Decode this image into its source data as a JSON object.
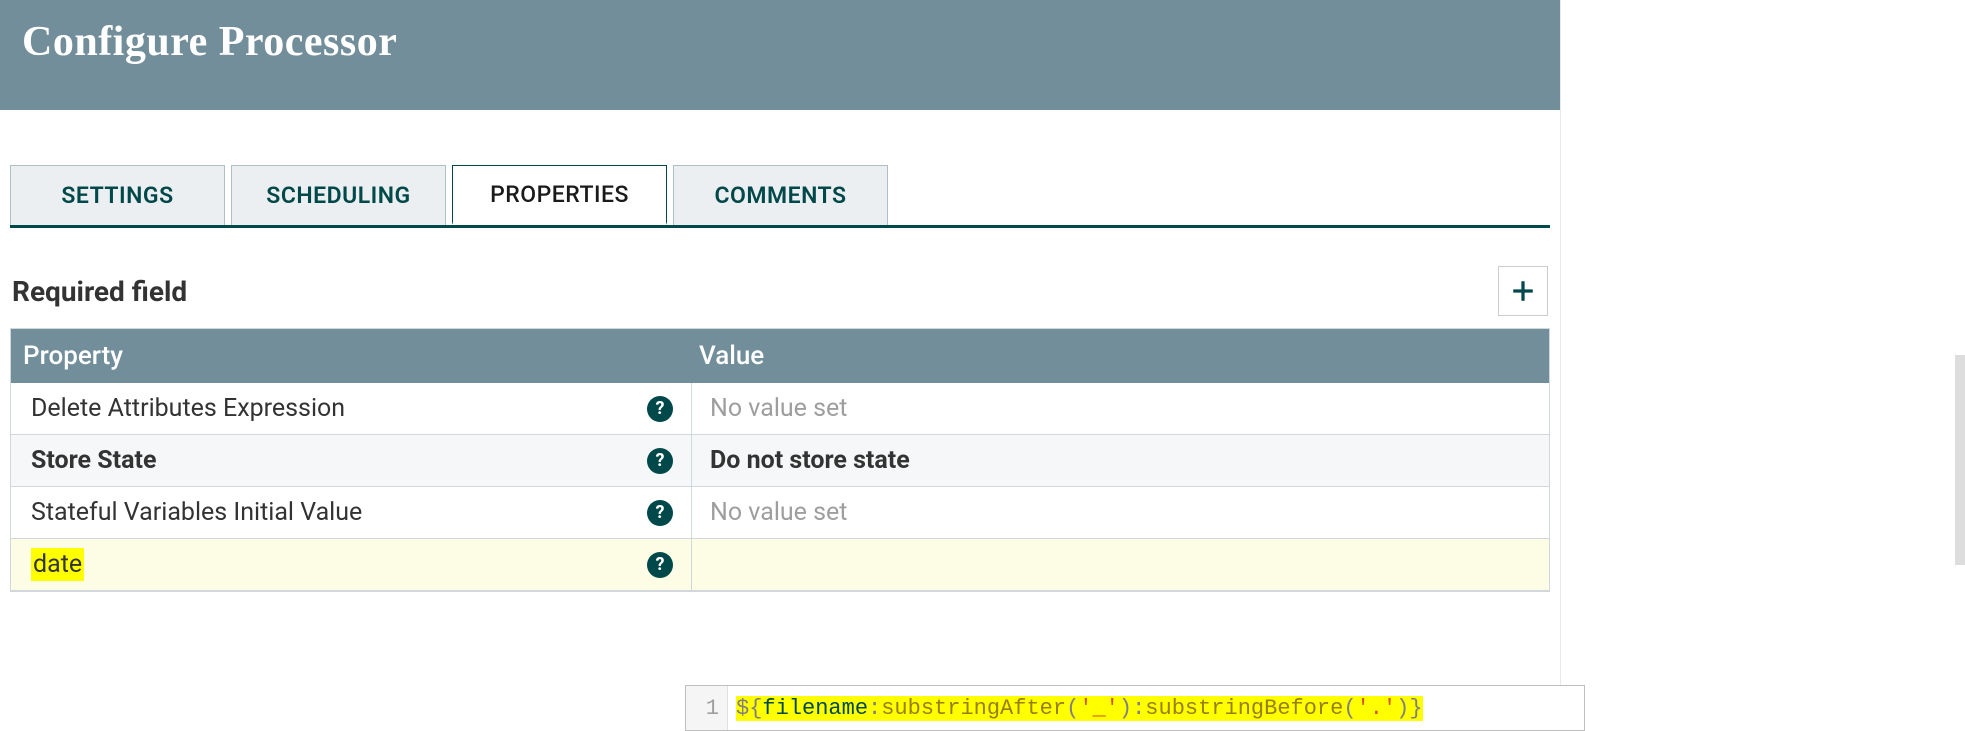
{
  "header": {
    "title": "Configure Processor"
  },
  "tabs": [
    {
      "label": "SETTINGS",
      "active": false
    },
    {
      "label": "SCHEDULING",
      "active": false
    },
    {
      "label": "PROPERTIES",
      "active": true
    },
    {
      "label": "COMMENTS",
      "active": false
    }
  ],
  "section": {
    "label": "Required field"
  },
  "columns": {
    "property": "Property",
    "value": "Value"
  },
  "rows": [
    {
      "property": "Delete Attributes Expression",
      "value": "No value set",
      "placeholder": true,
      "bold": false
    },
    {
      "property": "Store State",
      "value": "Do not store state",
      "placeholder": false,
      "bold": true
    },
    {
      "property": "Stateful Variables Initial Value",
      "value": "No value set",
      "placeholder": true,
      "bold": false
    },
    {
      "property": "date",
      "value": "",
      "placeholder": true,
      "bold": false,
      "highlighted": true
    }
  ],
  "editor": {
    "line_number": "1",
    "expression_raw": "${filename:substringAfter('_'):substringBefore('.')}",
    "tokens": {
      "open": "${",
      "var": "filename",
      "sep1": ":",
      "fn1": "substringAfter",
      "paren1o": "(",
      "arg1": "'_'",
      "paren1c": ")",
      "sep2": ":",
      "fn2": "substringBefore",
      "paren2o": "(",
      "arg2": "'.'",
      "paren2c": ")",
      "close": "}"
    }
  },
  "icons": {
    "help": "?",
    "plus": "+"
  }
}
